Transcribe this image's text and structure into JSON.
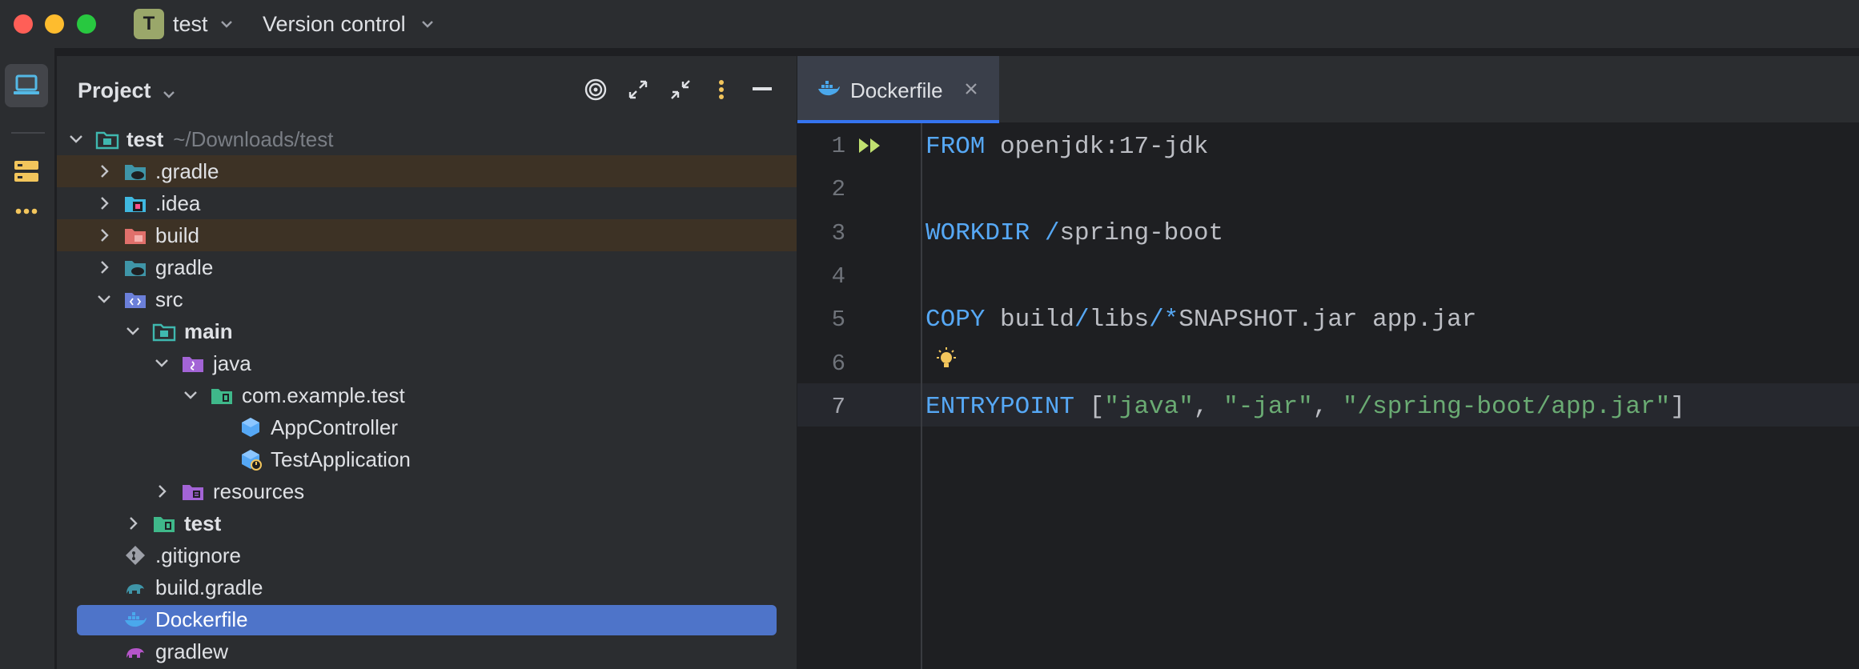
{
  "titlebar": {
    "project_initial": "T",
    "project_name": "test",
    "vcs_label": "Version control"
  },
  "project_panel": {
    "title": "Project",
    "tree": [
      {
        "name": "test",
        "path_hint": "~/Downloads/test",
        "depth": 0,
        "expanded": true,
        "bold": true,
        "icon": "module-folder-icon"
      },
      {
        "name": ".gradle",
        "depth": 1,
        "expanded": false,
        "icon": "gradle-folder-icon",
        "highlight": true
      },
      {
        "name": ".idea",
        "depth": 1,
        "expanded": false,
        "icon": "idea-folder-icon"
      },
      {
        "name": "build",
        "depth": 1,
        "expanded": false,
        "icon": "excluded-folder-icon",
        "highlight": true
      },
      {
        "name": "gradle",
        "depth": 1,
        "expanded": false,
        "icon": "gradle-folder-icon"
      },
      {
        "name": "src",
        "depth": 1,
        "expanded": true,
        "icon": "source-folder-icon"
      },
      {
        "name": "main",
        "depth": 2,
        "expanded": true,
        "bold": true,
        "icon": "module-folder-icon"
      },
      {
        "name": "java",
        "depth": 3,
        "expanded": true,
        "icon": "java-source-folder-icon"
      },
      {
        "name": "com.example.test",
        "depth": 4,
        "expanded": true,
        "icon": "package-icon"
      },
      {
        "name": "AppController",
        "depth": 5,
        "icon": "java-class-icon"
      },
      {
        "name": "TestApplication",
        "depth": 5,
        "icon": "spring-boot-class-icon"
      },
      {
        "name": "resources",
        "depth": 3,
        "expanded": false,
        "icon": "resources-folder-icon"
      },
      {
        "name": "test",
        "depth": 2,
        "expanded": false,
        "bold": true,
        "icon": "test-folder-icon"
      },
      {
        "name": ".gitignore",
        "depth": 1,
        "icon": "git-icon"
      },
      {
        "name": "build.gradle",
        "depth": 1,
        "icon": "gradle-elephant-icon"
      },
      {
        "name": "Dockerfile",
        "depth": 1,
        "icon": "docker-icon",
        "selected": true
      },
      {
        "name": "gradlew",
        "depth": 1,
        "icon": "gradle-script-icon"
      }
    ]
  },
  "editor": {
    "tab_label": "Dockerfile",
    "line_numbers": [
      "1",
      "2",
      "3",
      "4",
      "5",
      "6",
      "7"
    ],
    "current_line": "7",
    "code": {
      "l1_kw": "FROM",
      "l1_rest": " openjdk:17-jdk",
      "l3_kw": "WORKDIR",
      "l3_rest_slash": " /",
      "l3_rest": "spring-boot",
      "l5_kw": "COPY",
      "l5_a": " build",
      "l5_s1": "/",
      "l5_b": "libs",
      "l5_s2": "/*",
      "l5_c": "SNAPSHOT.jar app.jar",
      "l7_kw": "ENTRYPOINT",
      "l7_open": " [",
      "l7_s1": "\"java\"",
      "l7_c1": ", ",
      "l7_s2": "\"-jar\"",
      "l7_c2": ", ",
      "l7_s3": "\"/spring-boot/app.jar\"",
      "l7_close": "]"
    }
  },
  "colors": {
    "keyword": "#56a8f5",
    "string": "#6aab73",
    "selection": "#4e74c9",
    "excluded_highlight": "#3d3225"
  }
}
